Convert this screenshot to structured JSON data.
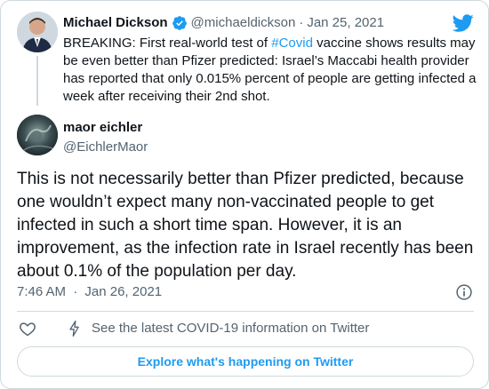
{
  "parent_tweet": {
    "author_name": "Michael Dickson",
    "handle": "@michaeldickson",
    "separator": "·",
    "date": "Jan 25, 2021",
    "text_before": "BREAKING: First real-world test of ",
    "hashtag": "#Covid",
    "text_after": " vaccine shows results may be even better than Pfizer predicted: Israel’s Maccabi health provider has reported that only 0.015% percent of people are getting infected a week after receiving their 2nd shot.",
    "avatar_icon": "person-avatar",
    "verified_icon": "verified-badge-icon"
  },
  "main_tweet": {
    "author_name": "maor eichler",
    "handle": "@EichlerMaor",
    "text": "This is not necessarily better than Pfizer predicted, because one wouldn’t expect many non-vaccinated people to get infected in such a short time span. However, it is an improvement, as the infection rate in Israel recently has been about 0.1% of the population per day.",
    "time": "7:46 AM",
    "separator": "·",
    "date": "Jan 26, 2021",
    "avatar_icon": "profile-image"
  },
  "actions": {
    "like_icon": "heart-icon",
    "covid_icon": "bolt-icon",
    "covid_info_link": "See the latest COVID-19 information on Twitter",
    "explore_button": "Explore what's happening on Twitter",
    "info_icon": "info-icon",
    "brand_icon": "twitter-bird-icon"
  },
  "colors": {
    "accent": "#1d9bf0",
    "text_primary": "#0f1419",
    "text_secondary": "#536471",
    "border": "#cfd9de"
  }
}
